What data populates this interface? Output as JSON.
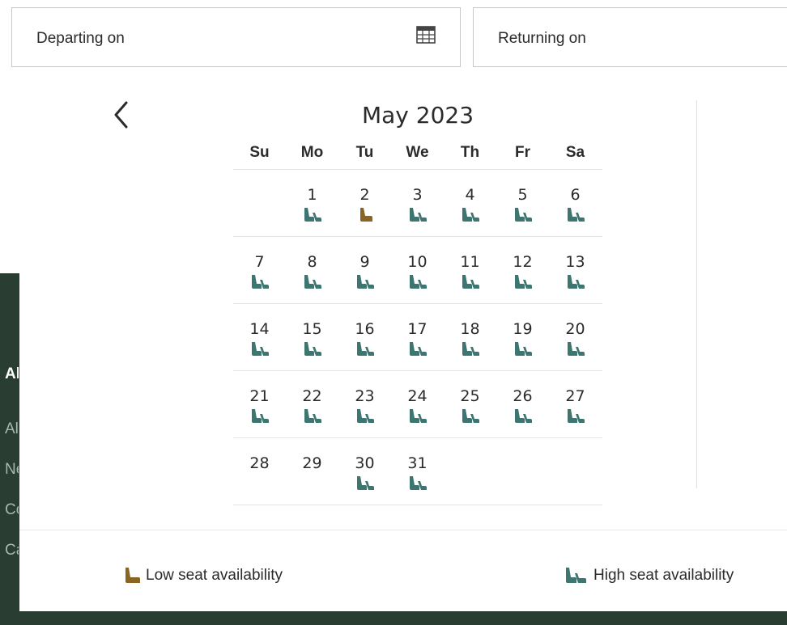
{
  "colors": {
    "low_seat": "#8a6422",
    "high_seat": "#3d7570",
    "footer_bg": "#2a3d33"
  },
  "search": {
    "departing_label": "Departing on",
    "returning_label": "Returning on",
    "calendar_icon": "calendar-icon"
  },
  "footer": {
    "heading": "Al",
    "links": [
      "Al",
      "Ne",
      "Co",
      "Ca"
    ]
  },
  "calendar": {
    "month_title": "May 2023",
    "prev_icon": "chevron-left-icon",
    "weekdays": [
      "Su",
      "Mo",
      "Tu",
      "We",
      "Th",
      "Fr",
      "Sa"
    ],
    "weeks": [
      [
        null,
        {
          "day": "1",
          "seat": "high"
        },
        {
          "day": "2",
          "seat": "low"
        },
        {
          "day": "3",
          "seat": "high"
        },
        {
          "day": "4",
          "seat": "high"
        },
        {
          "day": "5",
          "seat": "high"
        },
        {
          "day": "6",
          "seat": "high"
        }
      ],
      [
        {
          "day": "7",
          "seat": "high"
        },
        {
          "day": "8",
          "seat": "high"
        },
        {
          "day": "9",
          "seat": "high"
        },
        {
          "day": "10",
          "seat": "high"
        },
        {
          "day": "11",
          "seat": "high"
        },
        {
          "day": "12",
          "seat": "high"
        },
        {
          "day": "13",
          "seat": "high"
        }
      ],
      [
        {
          "day": "14",
          "seat": "high"
        },
        {
          "day": "15",
          "seat": "high"
        },
        {
          "day": "16",
          "seat": "high"
        },
        {
          "day": "17",
          "seat": "high"
        },
        {
          "day": "18",
          "seat": "high"
        },
        {
          "day": "19",
          "seat": "high"
        },
        {
          "day": "20",
          "seat": "high"
        }
      ],
      [
        {
          "day": "21",
          "seat": "high"
        },
        {
          "day": "22",
          "seat": "high"
        },
        {
          "day": "23",
          "seat": "high"
        },
        {
          "day": "24",
          "seat": "high"
        },
        {
          "day": "25",
          "seat": "high"
        },
        {
          "day": "26",
          "seat": "high"
        },
        {
          "day": "27",
          "seat": "high"
        }
      ],
      [
        {
          "day": "28",
          "seat": "none"
        },
        {
          "day": "29",
          "seat": "none"
        },
        {
          "day": "30",
          "seat": "high"
        },
        {
          "day": "31",
          "seat": "high"
        },
        null,
        null,
        null
      ]
    ]
  },
  "legend": {
    "low_label": "Low seat availability",
    "high_label": "High seat availability",
    "low_icon": "low-seat-icon",
    "high_icon": "high-seat-icon"
  }
}
